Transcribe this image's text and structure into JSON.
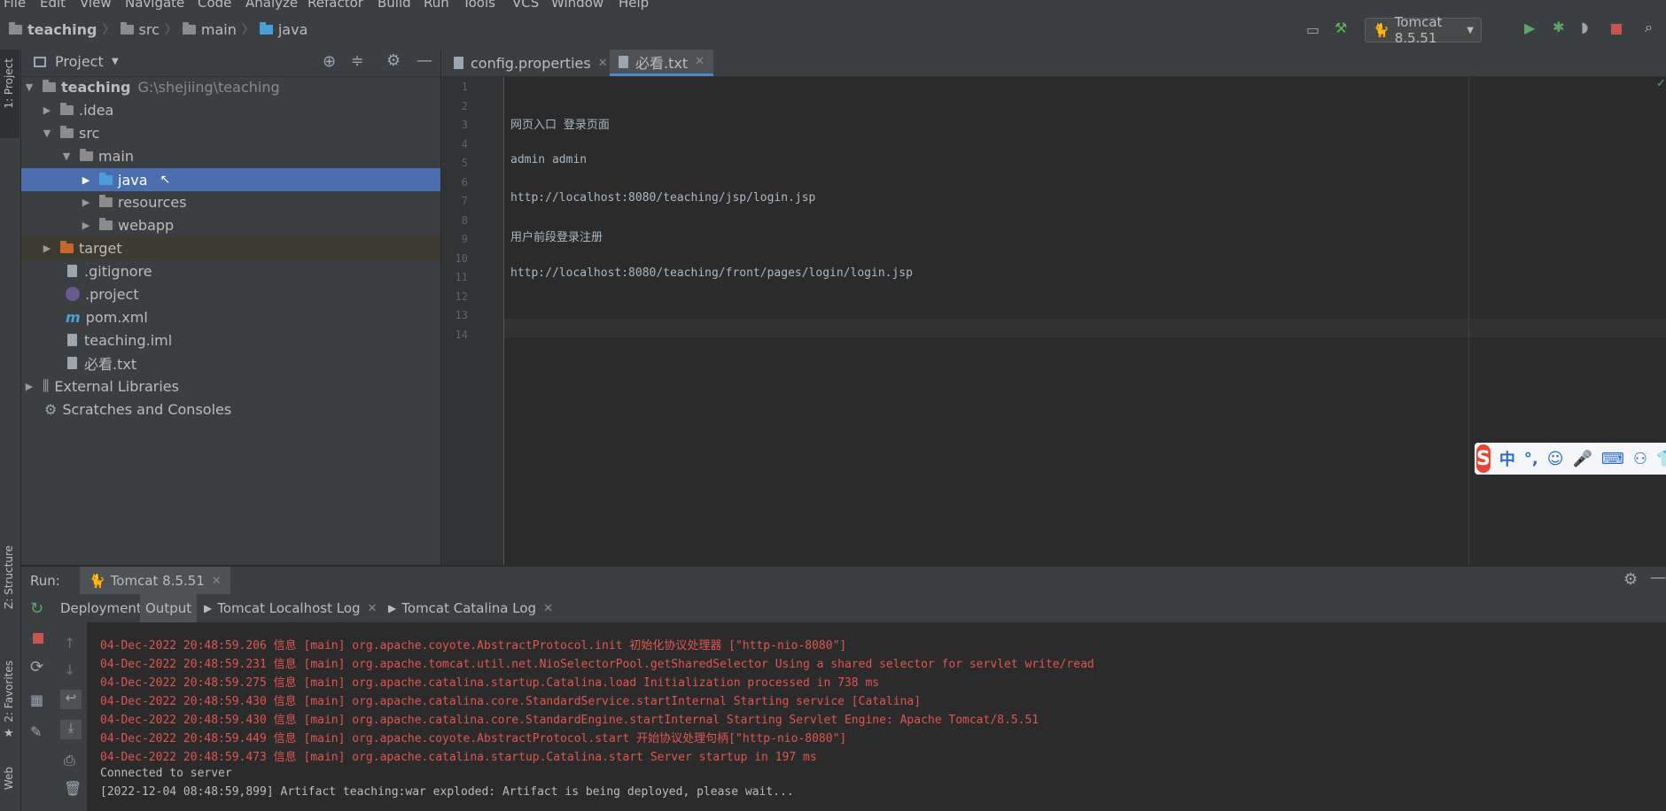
{
  "menu": [
    "File",
    "Edit",
    "View",
    "Navigate",
    "Code",
    "Analyze",
    "Refactor",
    "Build",
    "Run",
    "Tools",
    "VCS",
    "Window",
    "Help"
  ],
  "breadcrumb": [
    "teaching",
    "src",
    "main",
    "java"
  ],
  "run_config": "Tomcat 8.5.51",
  "side_tabs": {
    "project": "1: Project",
    "structure": "Z: Structure",
    "favorites": "2: Favorites",
    "web": "Web"
  },
  "project_panel": {
    "title": "Project",
    "tree": [
      {
        "label": "teaching",
        "path": "G:\\shejiing\\teaching"
      },
      {
        "label": ".idea"
      },
      {
        "label": "src"
      },
      {
        "label": "main"
      },
      {
        "label": "java"
      },
      {
        "label": "resources"
      },
      {
        "label": "webapp"
      },
      {
        "label": "target"
      },
      {
        "label": ".gitignore"
      },
      {
        "label": ".project"
      },
      {
        "label": "pom.xml"
      },
      {
        "label": "teaching.iml"
      },
      {
        "label": "必看.txt"
      },
      {
        "label": "External Libraries"
      },
      {
        "label": "Scratches and Consoles"
      }
    ]
  },
  "editor": {
    "tabs": [
      "config.properties",
      "必看.txt"
    ],
    "line_numbers": [
      "1",
      "2",
      "3",
      "4",
      "5",
      "6",
      "7",
      "8",
      "9",
      "10",
      "11",
      "12",
      "13",
      "14"
    ],
    "lines": {
      "l3": "网页入口 登录页面",
      "l5": "admin admin",
      "l7": "http://localhost:8080/teaching/jsp/login.jsp",
      "l9": "用户前段登录注册",
      "l11": "http://localhost:8080/teaching/front/pages/login/login.jsp"
    }
  },
  "ime": {
    "logo": "S",
    "items": [
      "中",
      "°,",
      "☺",
      "🎤",
      "⌨",
      "⚇",
      "👕"
    ]
  },
  "run_panel": {
    "label": "Run:",
    "config_tab": "Tomcat 8.5.51",
    "subtabs": [
      "Deployment",
      "Output",
      "Tomcat Localhost Log",
      "Tomcat Catalina Log"
    ],
    "log": [
      "04-Dec-2022 20:48:59.206 信息 [main] org.apache.coyote.AbstractProtocol.init 初始化协议处理器 [\"http-nio-8080\"]",
      "04-Dec-2022 20:48:59.231 信息 [main] org.apache.tomcat.util.net.NioSelectorPool.getSharedSelector Using a shared selector for servlet write/read",
      "04-Dec-2022 20:48:59.275 信息 [main] org.apache.catalina.startup.Catalina.load Initialization processed in 738 ms",
      "04-Dec-2022 20:48:59.430 信息 [main] org.apache.catalina.core.StandardService.startInternal Starting service [Catalina]",
      "04-Dec-2022 20:48:59.430 信息 [main] org.apache.catalina.core.StandardEngine.startInternal Starting Servlet Engine: Apache Tomcat/8.5.51",
      "04-Dec-2022 20:48:59.449 信息 [main] org.apache.coyote.AbstractProtocol.start 开始协议处理句柄[\"http-nio-8080\"]",
      "04-Dec-2022 20:48:59.473 信息 [main] org.apache.catalina.startup.Catalina.start Server startup in 197 ms",
      "Connected to server",
      "[2022-12-04 08:48:59,899] Artifact teaching:war exploded: Artifact is being deployed, please wait..."
    ]
  },
  "colors": {
    "log_red": "#e0554f",
    "log_plain": "#bbbbbb",
    "selection": "#4b6eaf",
    "accent": "#4a88c7"
  }
}
